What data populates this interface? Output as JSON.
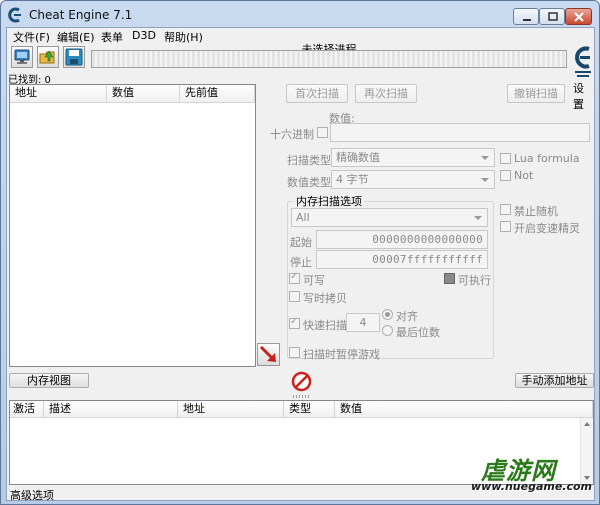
{
  "window": {
    "title": "Cheat Engine 7.1"
  },
  "menu": [
    "文件(F)",
    "编辑(E)",
    "表单",
    "D3D",
    "帮助(H)"
  ],
  "toolbar": {
    "process_label": "未选择进程",
    "settings_label": "设置"
  },
  "results": {
    "found_label": "已找到: 0",
    "columns": [
      "地址",
      "数值",
      "先前值"
    ]
  },
  "scan": {
    "first_scan": "首次扫描",
    "next_scan": "再次扫描",
    "undo_scan": "撤销扫描",
    "value_label": "数值:",
    "hex_label": "十六进制",
    "scan_type_label": "扫描类型",
    "scan_type_value": "精确数值",
    "value_type_label": "数值类型",
    "value_type_value": "4 字节",
    "lua_formula": "Lua formula",
    "not_label": "Not",
    "memory_options_title": "内存扫描选项",
    "region": "All",
    "start_label": "起始",
    "start_value": "0000000000000000",
    "stop_label": "停止",
    "stop_value": "00007fffffffffff",
    "writable": "可写",
    "executable": "可执行",
    "copy_on_write": "写时拷贝",
    "fast_scan": "快速扫描",
    "fast_scan_value": "4",
    "align": "对齐",
    "last_digits": "最后位数",
    "pause_game": "扫描时暂停游戏",
    "disable_random": "禁止随机",
    "speedhack": "开启变速精灵"
  },
  "buttons": {
    "memory_view": "内存视图",
    "add_address": "手动添加地址"
  },
  "address_list": {
    "columns": [
      "激活",
      "描述",
      "地址",
      "类型",
      "数值"
    ]
  },
  "footer": {
    "advanced": "高级选项"
  },
  "watermark": {
    "text": "虐游网",
    "url": "www.nuegame.com"
  }
}
